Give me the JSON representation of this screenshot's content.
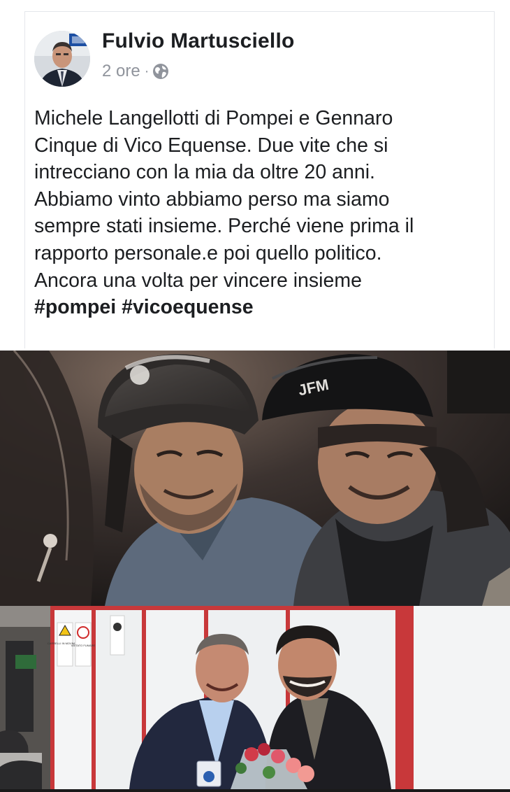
{
  "post": {
    "author": "Fulvio Martusciello",
    "time": "2 ore",
    "separator": "·",
    "privacy_icon": "globe-icon",
    "text_lines": [
      "Michele Langellotti di Pompei e Gennaro",
      "Cinque di Vico Equense. Due vite che si",
      "intrecciano con la mia da oltre 20 anni.",
      "Abbiamo vinto abbiamo  perso ma siamo",
      "sempre stati insieme. Perché viene prima il",
      "rapporto personale.e poi quello politico.",
      "Ancora una volta per vincere insieme"
    ],
    "hashtags": [
      "#pompei",
      "#vicoequense"
    ]
  },
  "photos": {
    "photo1": {
      "helmet_logo": "JFM"
    },
    "photo2": {
      "sign_1": "CARRELLI IN MOVIMENTO",
      "sign_2": "VIETATO FUMARE"
    }
  },
  "colors": {
    "author": "#1c1e21",
    "meta": "#90949c",
    "border": "#e4e6eb"
  }
}
